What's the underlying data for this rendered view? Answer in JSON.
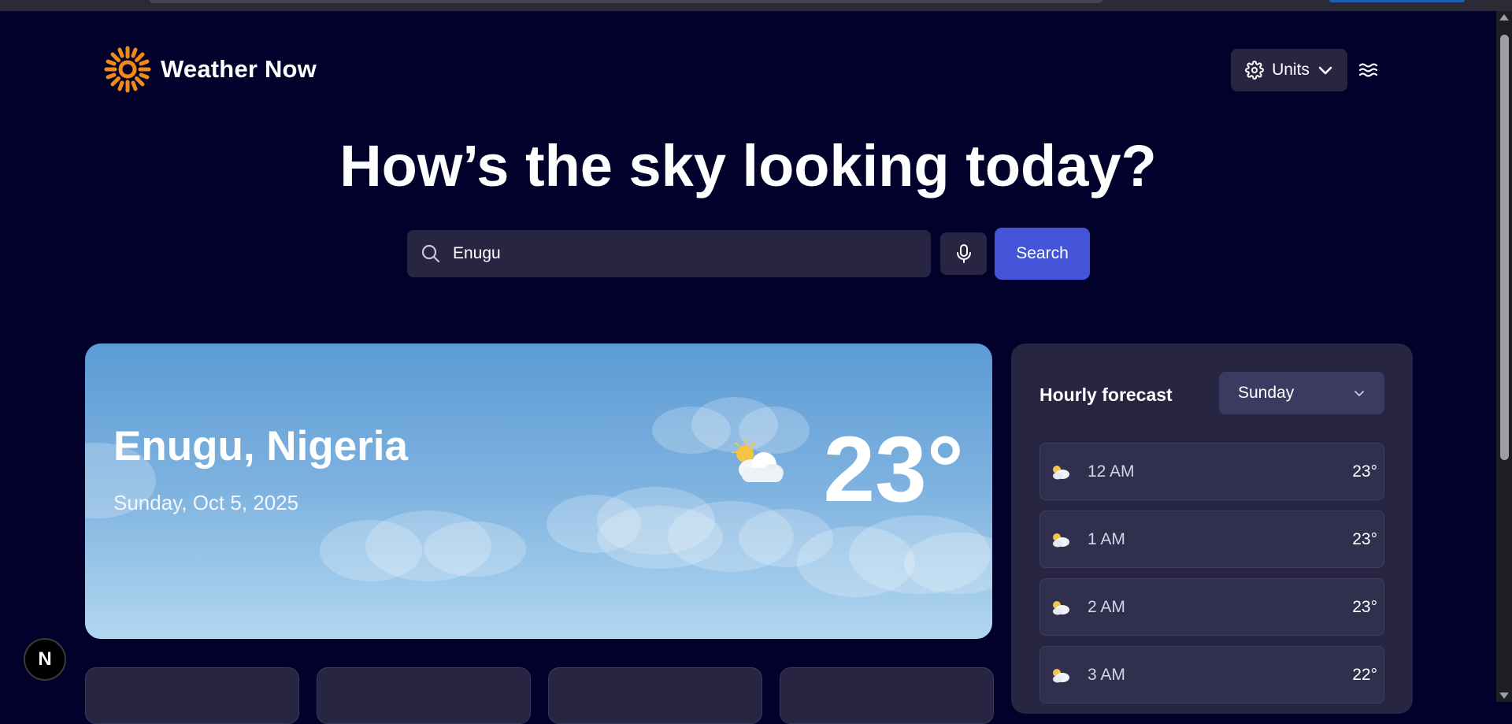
{
  "app": {
    "name": "Weather Now"
  },
  "header": {
    "units_label": "Units"
  },
  "hero": {
    "title": "How’s the sky looking today?"
  },
  "search": {
    "value": "Enugu",
    "button_label": "Search"
  },
  "current": {
    "location": "Enugu, Nigeria",
    "date": "Sunday, Oct 5, 2025",
    "temperature": "23°",
    "condition_icon": "partly-cloudy-icon"
  },
  "hourly": {
    "title": "Hourly forecast",
    "selected_day": "Sunday",
    "rows": [
      {
        "time": "12 AM",
        "temp": "23°",
        "icon": "partly-cloudy-icon"
      },
      {
        "time": "1 AM",
        "temp": "23°",
        "icon": "partly-cloudy-icon"
      },
      {
        "time": "2 AM",
        "temp": "23°",
        "icon": "partly-cloudy-icon"
      },
      {
        "time": "3 AM",
        "temp": "22°",
        "icon": "partly-cloudy-icon"
      }
    ]
  },
  "badge": {
    "label": "N"
  },
  "colors": {
    "background": "#02012b",
    "surface": "#272541",
    "accent": "#4455da",
    "sun": "#f28a1a"
  }
}
